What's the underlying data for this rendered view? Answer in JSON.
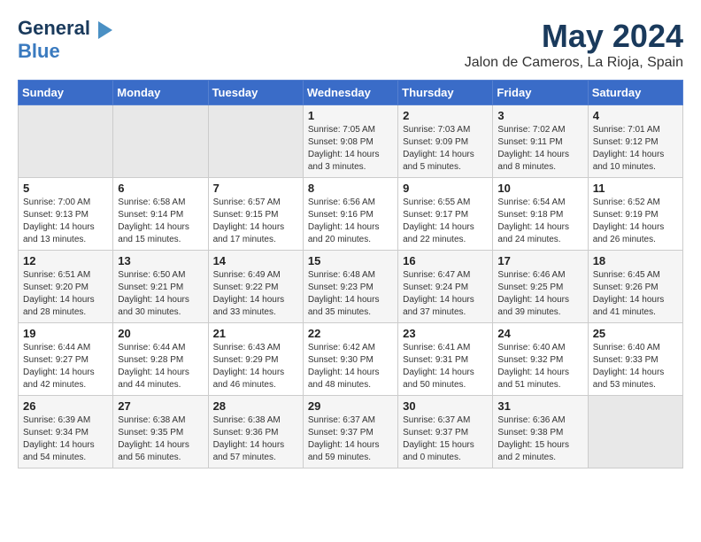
{
  "header": {
    "logo_line1": "General",
    "logo_line2": "Blue",
    "month": "May 2024",
    "location": "Jalon de Cameros, La Rioja, Spain"
  },
  "weekdays": [
    "Sunday",
    "Monday",
    "Tuesday",
    "Wednesday",
    "Thursday",
    "Friday",
    "Saturday"
  ],
  "weeks": [
    [
      {
        "day": "",
        "sunrise": "",
        "sunset": "",
        "daylight": ""
      },
      {
        "day": "",
        "sunrise": "",
        "sunset": "",
        "daylight": ""
      },
      {
        "day": "",
        "sunrise": "",
        "sunset": "",
        "daylight": ""
      },
      {
        "day": "1",
        "sunrise": "Sunrise: 7:05 AM",
        "sunset": "Sunset: 9:08 PM",
        "daylight": "Daylight: 14 hours and 3 minutes."
      },
      {
        "day": "2",
        "sunrise": "Sunrise: 7:03 AM",
        "sunset": "Sunset: 9:09 PM",
        "daylight": "Daylight: 14 hours and 5 minutes."
      },
      {
        "day": "3",
        "sunrise": "Sunrise: 7:02 AM",
        "sunset": "Sunset: 9:11 PM",
        "daylight": "Daylight: 14 hours and 8 minutes."
      },
      {
        "day": "4",
        "sunrise": "Sunrise: 7:01 AM",
        "sunset": "Sunset: 9:12 PM",
        "daylight": "Daylight: 14 hours and 10 minutes."
      }
    ],
    [
      {
        "day": "5",
        "sunrise": "Sunrise: 7:00 AM",
        "sunset": "Sunset: 9:13 PM",
        "daylight": "Daylight: 14 hours and 13 minutes."
      },
      {
        "day": "6",
        "sunrise": "Sunrise: 6:58 AM",
        "sunset": "Sunset: 9:14 PM",
        "daylight": "Daylight: 14 hours and 15 minutes."
      },
      {
        "day": "7",
        "sunrise": "Sunrise: 6:57 AM",
        "sunset": "Sunset: 9:15 PM",
        "daylight": "Daylight: 14 hours and 17 minutes."
      },
      {
        "day": "8",
        "sunrise": "Sunrise: 6:56 AM",
        "sunset": "Sunset: 9:16 PM",
        "daylight": "Daylight: 14 hours and 20 minutes."
      },
      {
        "day": "9",
        "sunrise": "Sunrise: 6:55 AM",
        "sunset": "Sunset: 9:17 PM",
        "daylight": "Daylight: 14 hours and 22 minutes."
      },
      {
        "day": "10",
        "sunrise": "Sunrise: 6:54 AM",
        "sunset": "Sunset: 9:18 PM",
        "daylight": "Daylight: 14 hours and 24 minutes."
      },
      {
        "day": "11",
        "sunrise": "Sunrise: 6:52 AM",
        "sunset": "Sunset: 9:19 PM",
        "daylight": "Daylight: 14 hours and 26 minutes."
      }
    ],
    [
      {
        "day": "12",
        "sunrise": "Sunrise: 6:51 AM",
        "sunset": "Sunset: 9:20 PM",
        "daylight": "Daylight: 14 hours and 28 minutes."
      },
      {
        "day": "13",
        "sunrise": "Sunrise: 6:50 AM",
        "sunset": "Sunset: 9:21 PM",
        "daylight": "Daylight: 14 hours and 30 minutes."
      },
      {
        "day": "14",
        "sunrise": "Sunrise: 6:49 AM",
        "sunset": "Sunset: 9:22 PM",
        "daylight": "Daylight: 14 hours and 33 minutes."
      },
      {
        "day": "15",
        "sunrise": "Sunrise: 6:48 AM",
        "sunset": "Sunset: 9:23 PM",
        "daylight": "Daylight: 14 hours and 35 minutes."
      },
      {
        "day": "16",
        "sunrise": "Sunrise: 6:47 AM",
        "sunset": "Sunset: 9:24 PM",
        "daylight": "Daylight: 14 hours and 37 minutes."
      },
      {
        "day": "17",
        "sunrise": "Sunrise: 6:46 AM",
        "sunset": "Sunset: 9:25 PM",
        "daylight": "Daylight: 14 hours and 39 minutes."
      },
      {
        "day": "18",
        "sunrise": "Sunrise: 6:45 AM",
        "sunset": "Sunset: 9:26 PM",
        "daylight": "Daylight: 14 hours and 41 minutes."
      }
    ],
    [
      {
        "day": "19",
        "sunrise": "Sunrise: 6:44 AM",
        "sunset": "Sunset: 9:27 PM",
        "daylight": "Daylight: 14 hours and 42 minutes."
      },
      {
        "day": "20",
        "sunrise": "Sunrise: 6:44 AM",
        "sunset": "Sunset: 9:28 PM",
        "daylight": "Daylight: 14 hours and 44 minutes."
      },
      {
        "day": "21",
        "sunrise": "Sunrise: 6:43 AM",
        "sunset": "Sunset: 9:29 PM",
        "daylight": "Daylight: 14 hours and 46 minutes."
      },
      {
        "day": "22",
        "sunrise": "Sunrise: 6:42 AM",
        "sunset": "Sunset: 9:30 PM",
        "daylight": "Daylight: 14 hours and 48 minutes."
      },
      {
        "day": "23",
        "sunrise": "Sunrise: 6:41 AM",
        "sunset": "Sunset: 9:31 PM",
        "daylight": "Daylight: 14 hours and 50 minutes."
      },
      {
        "day": "24",
        "sunrise": "Sunrise: 6:40 AM",
        "sunset": "Sunset: 9:32 PM",
        "daylight": "Daylight: 14 hours and 51 minutes."
      },
      {
        "day": "25",
        "sunrise": "Sunrise: 6:40 AM",
        "sunset": "Sunset: 9:33 PM",
        "daylight": "Daylight: 14 hours and 53 minutes."
      }
    ],
    [
      {
        "day": "26",
        "sunrise": "Sunrise: 6:39 AM",
        "sunset": "Sunset: 9:34 PM",
        "daylight": "Daylight: 14 hours and 54 minutes."
      },
      {
        "day": "27",
        "sunrise": "Sunrise: 6:38 AM",
        "sunset": "Sunset: 9:35 PM",
        "daylight": "Daylight: 14 hours and 56 minutes."
      },
      {
        "day": "28",
        "sunrise": "Sunrise: 6:38 AM",
        "sunset": "Sunset: 9:36 PM",
        "daylight": "Daylight: 14 hours and 57 minutes."
      },
      {
        "day": "29",
        "sunrise": "Sunrise: 6:37 AM",
        "sunset": "Sunset: 9:37 PM",
        "daylight": "Daylight: 14 hours and 59 minutes."
      },
      {
        "day": "30",
        "sunrise": "Sunrise: 6:37 AM",
        "sunset": "Sunset: 9:37 PM",
        "daylight": "Daylight: 15 hours and 0 minutes."
      },
      {
        "day": "31",
        "sunrise": "Sunrise: 6:36 AM",
        "sunset": "Sunset: 9:38 PM",
        "daylight": "Daylight: 15 hours and 2 minutes."
      },
      {
        "day": "",
        "sunrise": "",
        "sunset": "",
        "daylight": ""
      }
    ]
  ]
}
